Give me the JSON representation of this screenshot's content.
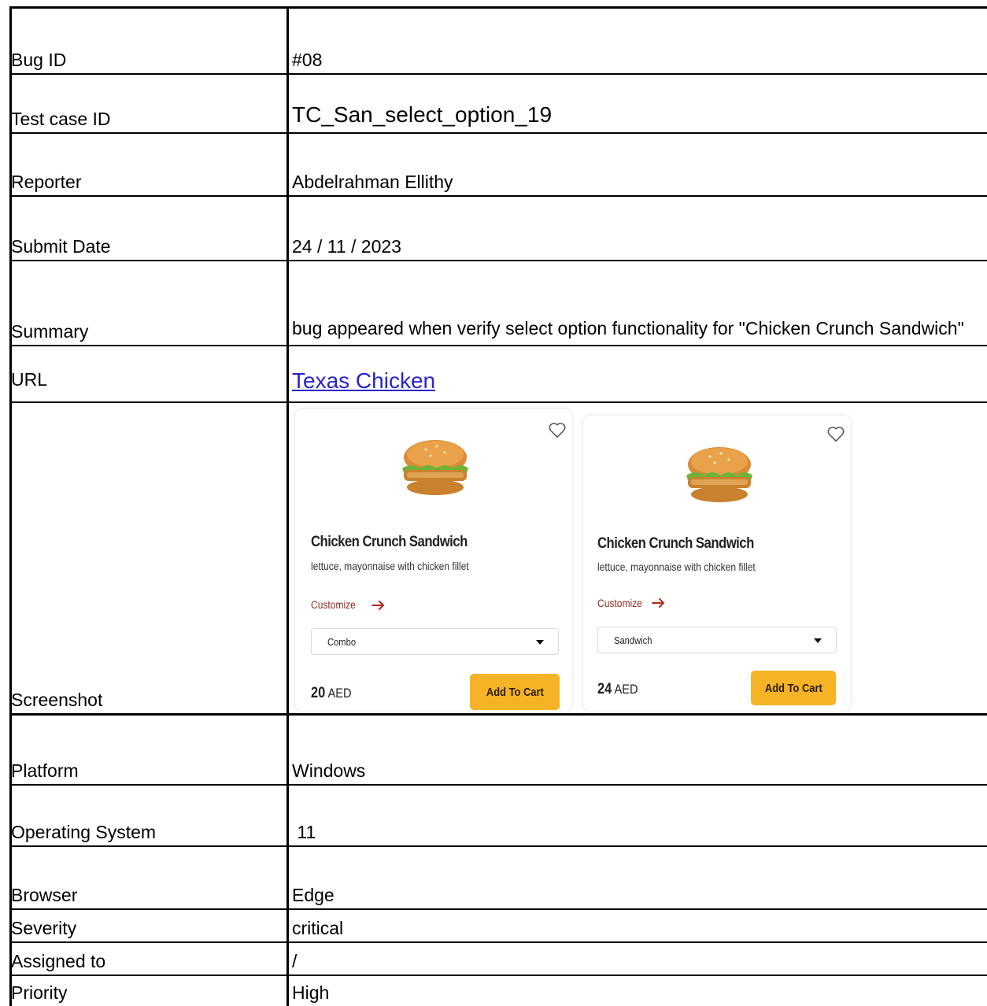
{
  "rows": [
    {
      "label": "Bug ID",
      "value": "#08"
    },
    {
      "label": "Test case ID",
      "value": "TC_San_select_option_19"
    },
    {
      "label": "Reporter",
      "value": "Abdelrahman Ellithy"
    },
    {
      "label": "Submit Date",
      "value": "24 / 11 / 2023"
    },
    {
      "label": "Summary",
      "value": "bug appeared when verify select option functionality for \"Chicken Crunch Sandwich\""
    },
    {
      "label": "URL",
      "value": "Texas Chicken"
    },
    {
      "label": "Screenshot",
      "value": ""
    },
    {
      "label": "Platform",
      "value": "Windows"
    },
    {
      "label": "Operating System",
      "value": " 11"
    },
    {
      "label": "Browser",
      "value": "Edge"
    },
    {
      "label": "Severity",
      "value": "critical"
    },
    {
      "label": "Assigned to",
      "value": "/"
    },
    {
      "label": "Priority",
      "value": "High"
    }
  ],
  "cards": [
    {
      "title": "Chicken Crunch Sandwich",
      "description": "lettuce, mayonnaise with chicken fillet",
      "customize_label": "Customize",
      "selected_option": "Combo",
      "price_number": "20",
      "price_currency": "AED",
      "add_to_cart_label": "Add To Cart"
    },
    {
      "title": "Chicken Crunch Sandwich",
      "description": "lettuce, mayonnaise with chicken fillet",
      "customize_label": "Customize",
      "selected_option": "Sandwich",
      "price_number": "24",
      "price_currency": "AED",
      "add_to_cart_label": "Add To Cart"
    }
  ],
  "colors": {
    "link": "#2a24c8",
    "button": "#f5b325",
    "customize": "#8b2a1c"
  },
  "icons": [
    "heart-icon",
    "burger-image",
    "arrow-right-icon",
    "caret-down-icon"
  ]
}
